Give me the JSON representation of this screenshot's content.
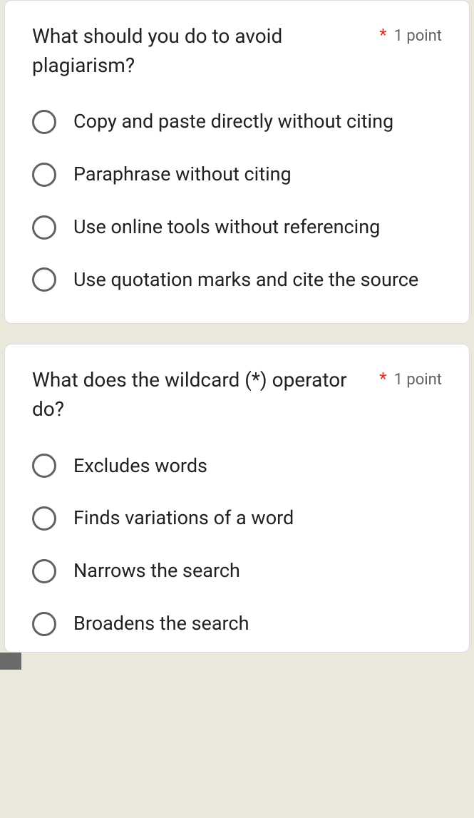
{
  "questions": [
    {
      "text": "What should you do to avoid plagiarism?",
      "required_mark": "*",
      "points": "1 point",
      "options": [
        "Copy and paste directly without citing",
        "Paraphrase without citing",
        "Use online tools without referencing",
        "Use quotation marks and cite the source"
      ]
    },
    {
      "text": "What does the wildcard (*) operator do?",
      "required_mark": "*",
      "points": "1 point",
      "options": [
        "Excludes words",
        "Finds variations of a word",
        "Narrows the search",
        "Broadens the search"
      ]
    }
  ]
}
